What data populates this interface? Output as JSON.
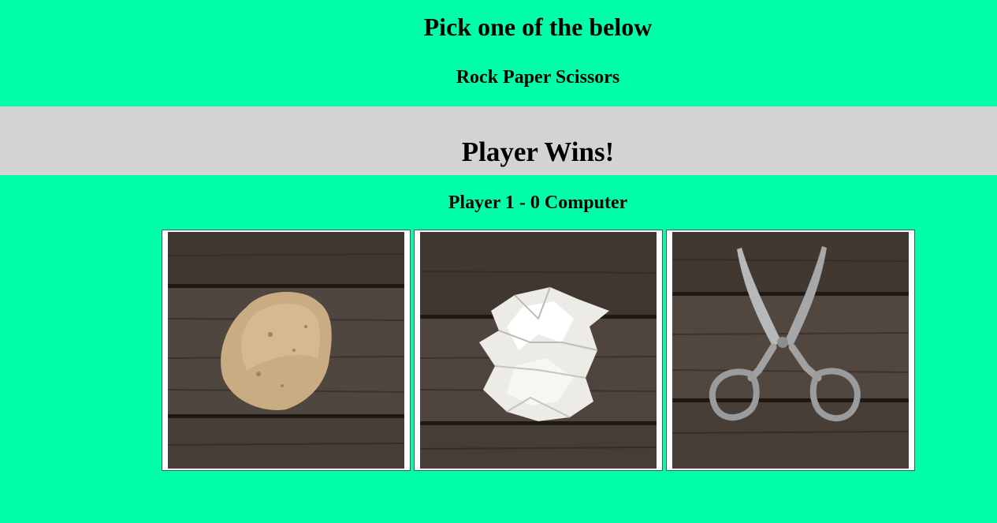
{
  "header": {
    "title": "Pick one of the below",
    "subtitle": "Rock Paper Scissors"
  },
  "result": {
    "text": "Player Wins!",
    "bar_color": "#D3D3D3"
  },
  "score": {
    "text": "Player 1 - 0 Computer"
  },
  "choices": [
    {
      "name": "rock",
      "icon": "rock-image"
    },
    {
      "name": "paper",
      "icon": "paper-image"
    },
    {
      "name": "scissors",
      "icon": "scissors-image"
    }
  ],
  "colors": {
    "background": "#00FFA8",
    "wood": "#4a4038"
  }
}
